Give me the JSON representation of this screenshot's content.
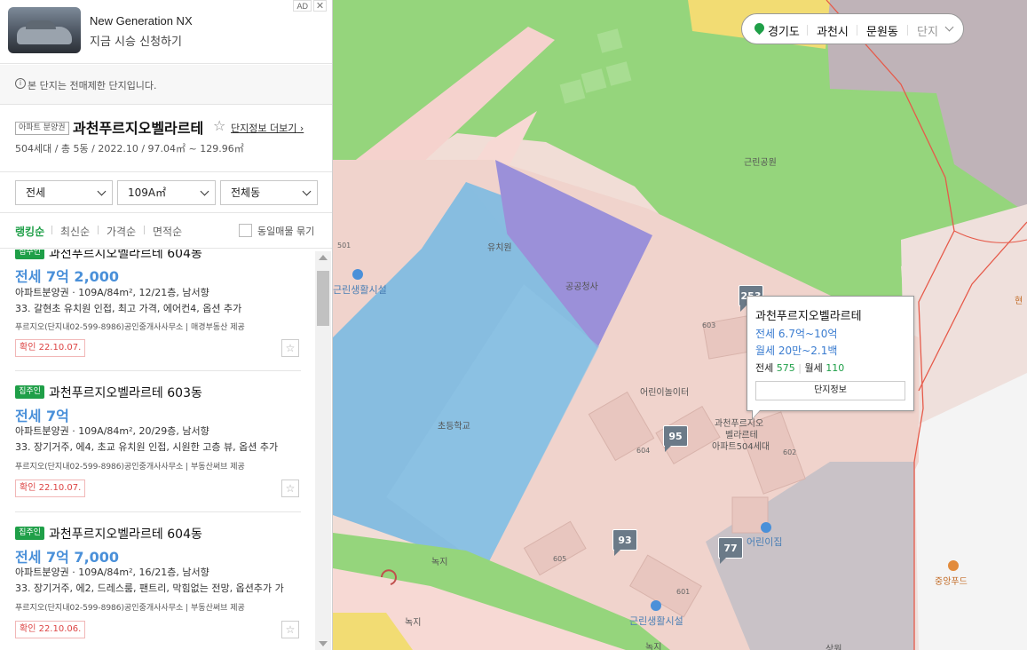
{
  "ad": {
    "title": "New Generation NX",
    "subtitle": "지금 시승 신청하기",
    "badge": "AD",
    "close": "✕"
  },
  "notice": {
    "icon": "i",
    "text": "본 단지는 전매제한 단지입니다."
  },
  "complex": {
    "type": "아파트 분양권",
    "name": "과천푸르지오벨라르테",
    "more_label": "단지정보 더보기",
    "meta": "504세대 / 총 5동 / 2022.10 / 97.04㎡ ~ 129.96㎡"
  },
  "filters": [
    {
      "value": "전세"
    },
    {
      "value": "109A㎡"
    },
    {
      "value": "전체동"
    }
  ],
  "sort": {
    "options": [
      "랭킹순",
      "최신순",
      "가격순",
      "면적순"
    ],
    "active": 0,
    "bundle_label": "동일매물 묶기"
  },
  "listings": [
    {
      "tag": "집주인",
      "name": "과천푸르지오벨라르테 604동",
      "price": "전세 7억 2,000",
      "spec": "아파트분양권 · 109A/84m², 12/21층, 남서향",
      "desc": "33. 갈현초 유치원 인접, 최고 가격, 에어컨4, 옵션 추가",
      "agent": "푸르지오(단지내02-599-8986)공인중개사사무소 | 매경부동산 제공",
      "confirm": "확인 22.10.07."
    },
    {
      "tag": "집주인",
      "name": "과천푸르지오벨라르테 603동",
      "price": "전세 7억",
      "spec": "아파트분양권 · 109A/84m², 20/29층, 남서향",
      "desc": "33. 장기거주, 에4, 초교 유치원 인접, 시원한 고층 뷰, 옵션 추가",
      "agent": "푸르지오(단지내02-599-8986)공인중개사사무소 | 부동산써브 제공",
      "confirm": "확인 22.10.07."
    },
    {
      "tag": "집주인",
      "name": "과천푸르지오벨라르테 604동",
      "price": "전세 7억 7,000",
      "spec": "아파트분양권 · 109A/84m², 16/21층, 남서향",
      "desc": "33. 장기거주, 에2, 드레스룸, 팬트리, 막힘없는 전망, 옵션추가 가",
      "agent": "푸르지오(단지내02-599-8986)공인중개사사무소 | 부동산써브 제공",
      "confirm": "확인 22.10.06."
    }
  ],
  "location": {
    "province": "경기도",
    "city": "과천시",
    "dong": "문원동",
    "mode": "단지"
  },
  "popup": {
    "name": "과천푸르지오벨라르테",
    "jeonse": "전세 6.7억~10억",
    "wolse": "월세 20만~2.1백",
    "count_jeonse_label": "전세",
    "count_jeonse": "575",
    "count_wolse_label": "월세",
    "count_wolse": "110",
    "button": "단지정보"
  },
  "map": {
    "labels": {
      "park": "근린공원",
      "kindergarten": "유치원",
      "office": "공공청사",
      "school": "초등학교",
      "playground": "어린이놀이터",
      "complex_label_1": "과천푸르지오",
      "complex_label_2": "벨라르테",
      "complex_label_3": "아파트504세대",
      "facility_left": "근린생활시설",
      "facility_bottom": "근린생활시설",
      "daycare": "어린이집",
      "green1": "녹지",
      "green2": "녹지",
      "green3": "녹지",
      "food": "중앙푸드",
      "right_edge": "현",
      "bottom_road": "상원"
    },
    "lot_numbers": [
      "501",
      "603",
      "604",
      "602",
      "605",
      "601"
    ],
    "markers": [
      {
        "count": "253"
      },
      {
        "count": "95"
      },
      {
        "count": "93"
      },
      {
        "count": "77"
      }
    ]
  }
}
